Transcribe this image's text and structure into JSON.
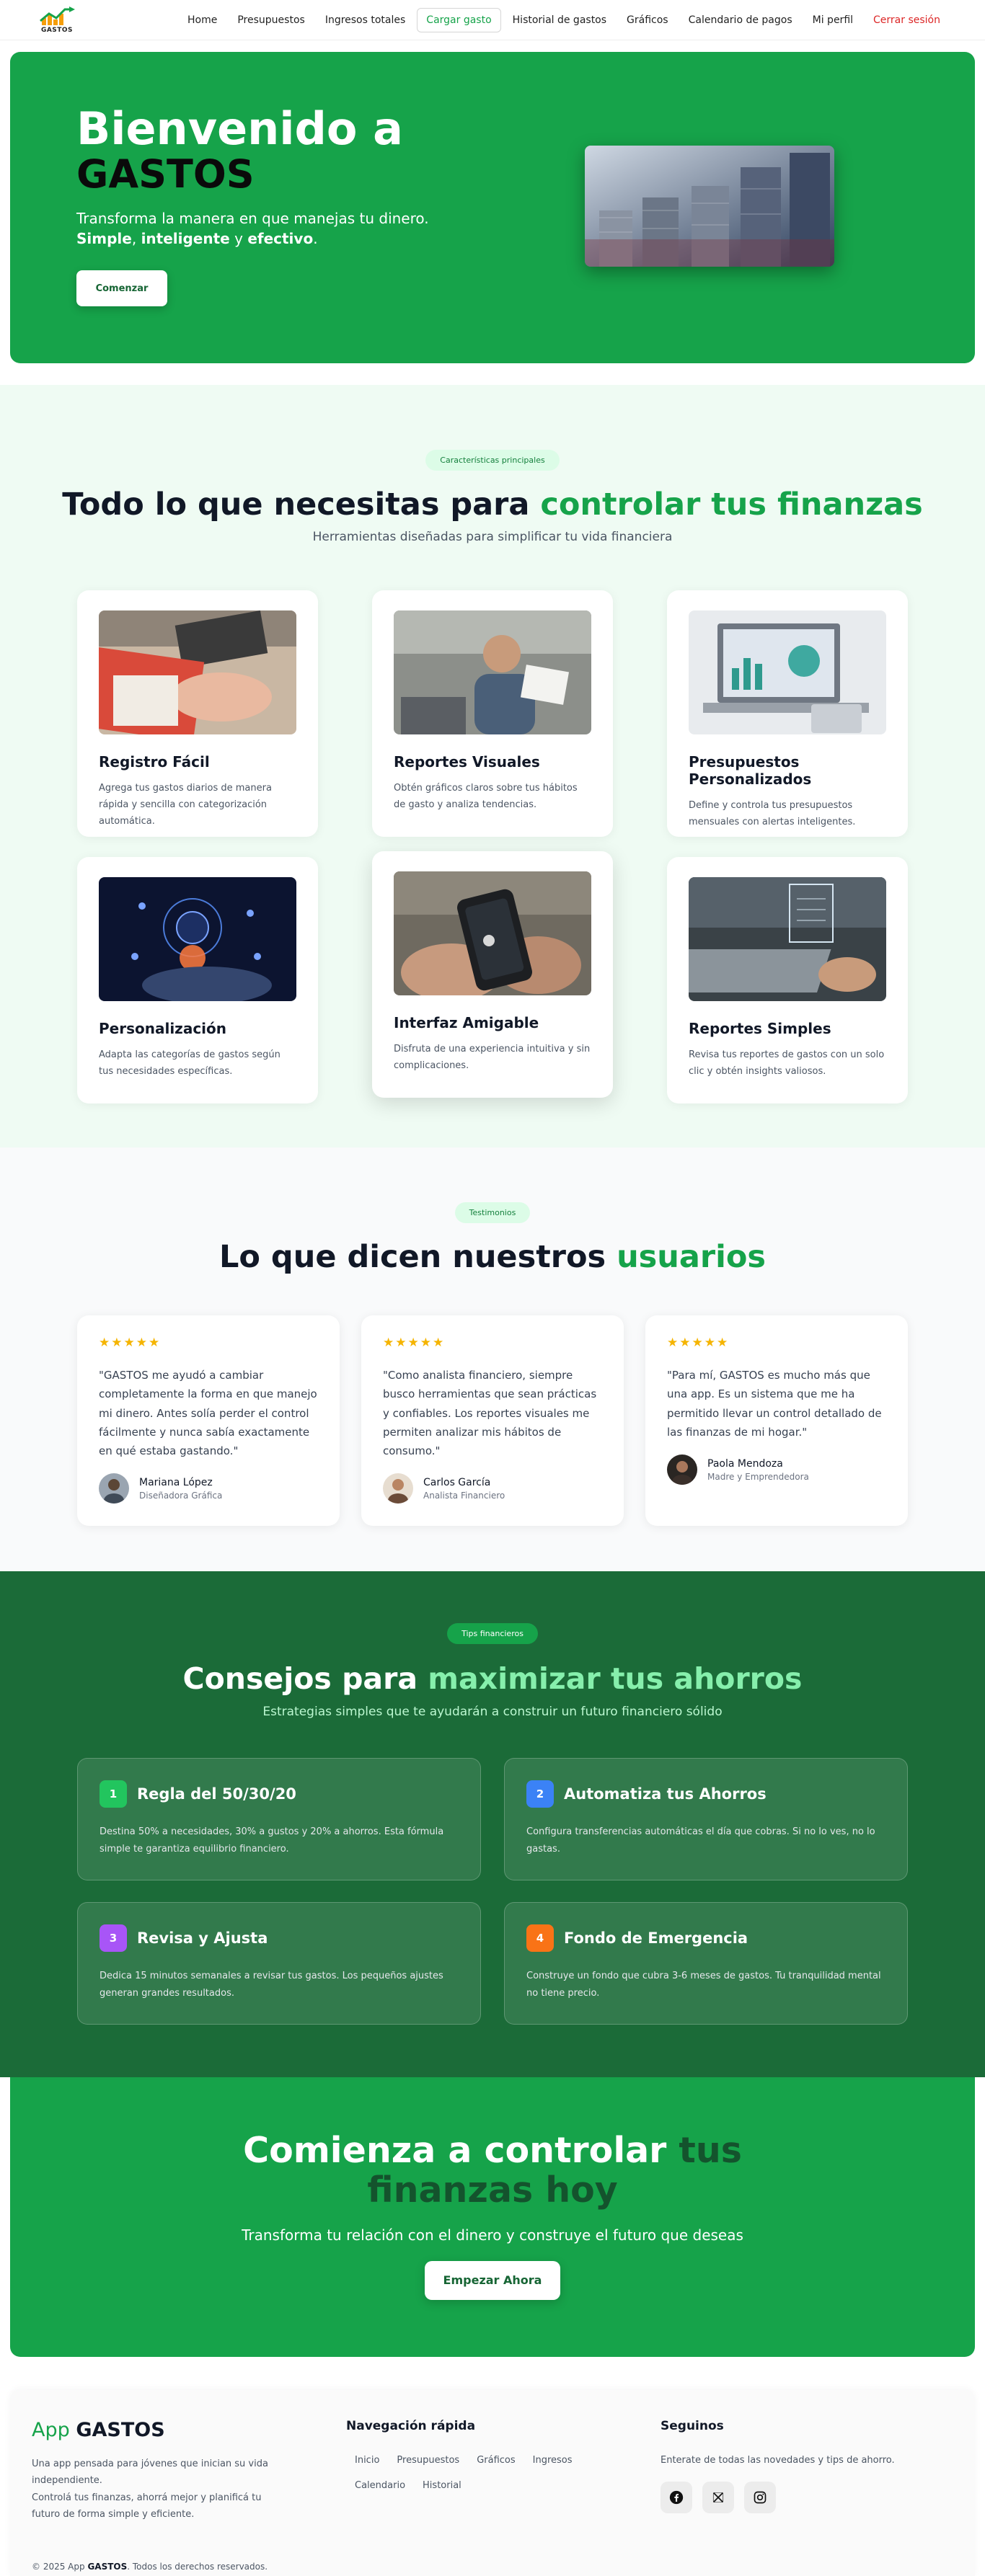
{
  "brand": {
    "logo_text": "GASTOS"
  },
  "nav": {
    "items": [
      {
        "label": "Home"
      },
      {
        "label": "Presupuestos"
      },
      {
        "label": "Ingresos totales"
      },
      {
        "label": "Cargar gasto"
      },
      {
        "label": "Historial de gastos"
      },
      {
        "label": "Gráficos"
      },
      {
        "label": "Calendario de pagos"
      },
      {
        "label": "Mi perfil"
      }
    ],
    "active": "Cargar gasto",
    "logout": "Cerrar sesión"
  },
  "hero": {
    "title_1": "Bienvenido a",
    "title_2": "GASTOS",
    "subtitle": "Transforma la manera en que manejas tu dinero.",
    "bold_1": "Simple",
    "sep_1": ", ",
    "bold_2": "inteligente",
    "sep_2": " y ",
    "bold_3": "efectivo",
    "end": ".",
    "button": "Comenzar",
    "image": "coins-stacks-photo"
  },
  "features": {
    "badge": "Características principales",
    "title_plain": "Todo lo que necesitas para ",
    "title_accent": "controlar tus finanzas",
    "subtitle": "Herramientas diseñadas para simplificar tu vida financiera",
    "cards": [
      {
        "title": "Registro Fácil",
        "desc": "Agrega tus gastos diarios de manera rápida y sencilla con categorización automática."
      },
      {
        "title": "Reportes Visuales",
        "desc": "Obtén gráficos claros sobre tus hábitos de gasto y analiza tendencias."
      },
      {
        "title": "Presupuestos Personalizados",
        "desc": "Define y controla tus presupuestos mensuales con alertas inteligentes."
      },
      {
        "title": "Personalización",
        "desc": "Adapta las categorías de gastos según tus necesidades específicas."
      },
      {
        "title": "Interfaz Amigable",
        "desc": "Disfruta de una experiencia intuitiva y sin complicaciones."
      },
      {
        "title": "Reportes Simples",
        "desc": "Revisa tus reportes de gastos con un solo clic y obtén insights valiosos."
      }
    ]
  },
  "testimonials": {
    "badge": "Testimonios",
    "title_plain": "Lo que dicen nuestros ",
    "title_accent": "usuarios",
    "items": [
      {
        "stars": "★★★★★",
        "quote": "\"GASTOS me ayudó a cambiar completamente la forma en que manejo mi dinero. Antes solía perder el control fácilmente y nunca sabía exactamente en qué estaba gastando.\"",
        "name": "Mariana López",
        "role": "Diseñadora Gráfica"
      },
      {
        "stars": "★★★★★",
        "quote": "\"Como analista financiero, siempre busco herramientas que sean prácticas y confiables. Los reportes visuales me permiten analizar mis hábitos de consumo.\"",
        "name": "Carlos García",
        "role": "Analista Financiero"
      },
      {
        "stars": "★★★★★",
        "quote": "\"Para mí, GASTOS es mucho más que una app. Es un sistema que me ha permitido llevar un control detallado de las finanzas de mi hogar.\"",
        "name": "Paola Mendoza",
        "role": "Madre y Emprendedora"
      }
    ]
  },
  "tips": {
    "badge": "Tips financieros",
    "title_plain": "Consejos para ",
    "title_accent": "maximizar tus ahorros",
    "subtitle": "Estrategias simples que te ayudarán a construir un futuro financiero sólido",
    "items": [
      {
        "num": "1",
        "color": "#22c55e",
        "title": "Regla del 50/30/20",
        "desc": "Destina 50% a necesidades, 30% a gustos y 20% a ahorros. Esta fórmula simple te garantiza equilibrio financiero."
      },
      {
        "num": "2",
        "color": "#3b82f6",
        "title": "Automatiza tus Ahorros",
        "desc": "Configura transferencias automáticas el día que cobras. Si no lo ves, no lo gastas."
      },
      {
        "num": "3",
        "color": "#a855f7",
        "title": "Revisa y Ajusta",
        "desc": "Dedica 15 minutos semanales a revisar tus gastos. Los pequeños ajustes generan grandes resultados."
      },
      {
        "num": "4",
        "color": "#f97316",
        "title": "Fondo de Emergencia",
        "desc": "Construye un fondo que cubra 3-6 meses de gastos. Tu tranquilidad mental no tiene precio."
      }
    ]
  },
  "cta": {
    "title_plain": "Comienza a controlar ",
    "title_accent": "tus finanzas hoy",
    "subtitle": "Transforma tu relación con el dinero y construye el futuro que deseas",
    "button": "Empezar Ahora"
  },
  "footer": {
    "brand_plain": "App ",
    "brand_bold": "GASTOS",
    "desc_1": "Una app pensada para jóvenes que inician su vida independiente.",
    "desc_2": "Controlá tus finanzas, ahorrá mejor y planificá tu futuro de forma simple y eficiente.",
    "nav_heading": "Navegación rápida",
    "nav_links": [
      "Inicio",
      "Presupuestos",
      "Gráficos",
      "Ingresos",
      "Calendario",
      "Historial"
    ],
    "follow_heading": "Seguinos",
    "follow_text": "Enterate de todas las novedades y tips de ahorro.",
    "socials": [
      "facebook-icon",
      "x-icon",
      "instagram-icon"
    ],
    "copyright_pre": "© 2025 App ",
    "copyright_bold": "GASTOS",
    "copyright_post": ". Todos los derechos reservados."
  }
}
